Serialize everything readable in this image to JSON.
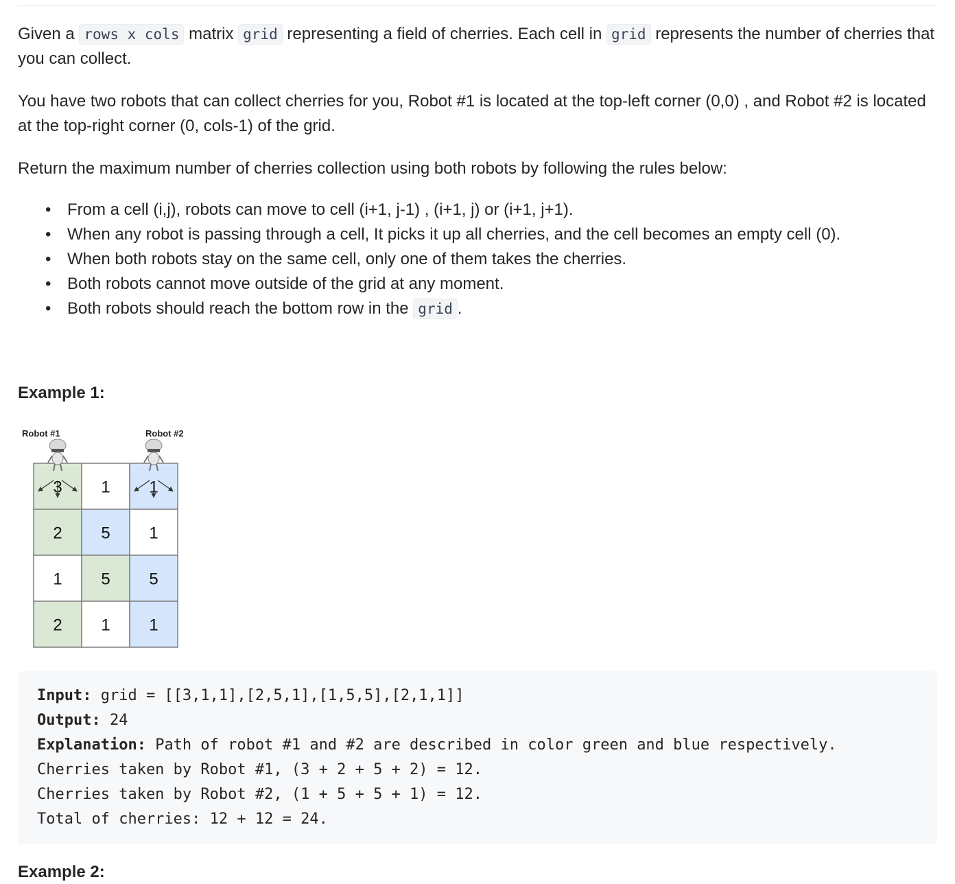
{
  "description": {
    "p1": {
      "t1": "Given a ",
      "code1": "rows x cols",
      "t2": " matrix ",
      "code2": "grid",
      "t3": " representing a field of cherries. Each cell in ",
      "code3": "grid",
      "t4": " represents the number of cherries that you can collect."
    },
    "p2": "You have two robots that can collect cherries for you, Robot #1 is located at the top-left corner (0,0) , and Robot #2 is located at the top-right corner (0, cols-1) of the grid.",
    "p3": "Return the maximum number of cherries collection using both robots  by following the rules below:",
    "rules": [
      "From a cell (i,j), robots can move to cell (i+1, j-1) , (i+1, j) or (i+1, j+1).",
      "When any robot is passing through a cell, It picks it up all cherries, and the cell becomes an empty cell (0).",
      "When both robots stay on the same cell, only one of them takes the cherries.",
      "Both robots cannot move outside of the grid at any moment."
    ],
    "rule5": {
      "t1": "Both robots should reach the bottom row in the ",
      "code": "grid",
      "t2": "."
    },
    "bullet": "•"
  },
  "example1": {
    "title": "Example 1:",
    "figure": {
      "robot1_label": "Robot #1",
      "robot2_label": "Robot #2",
      "grid": [
        [
          "3",
          "1",
          "1"
        ],
        [
          "2",
          "5",
          "1"
        ],
        [
          "1",
          "5",
          "5"
        ],
        [
          "2",
          "1",
          "1"
        ]
      ],
      "cell_colors": [
        [
          "green",
          "white",
          "blue"
        ],
        [
          "green",
          "blue",
          "white"
        ],
        [
          "white",
          "green",
          "blue"
        ],
        [
          "green",
          "white",
          "blue"
        ]
      ],
      "colors": {
        "green": "#dae8d5",
        "blue": "#d5e5fb",
        "white": "#ffffff",
        "border": "#7f7f7f"
      }
    },
    "input_label": "Input:",
    "input_value": " grid = [[3,1,1],[2,5,1],[1,5,5],[2,1,1]]",
    "output_label": "Output:",
    "output_value": " 24",
    "explanation_label": "Explanation:",
    "explanation_value": " Path of robot #1 and #2 are described in color green and blue respectively.",
    "line4": "Cherries taken by Robot #1, (3 + 2 + 5 + 2) = 12.",
    "line5": "Cherries taken by Robot #2, (1 + 5 + 5 + 1) = 12.",
    "line6": "Total of cherries: 12 + 12 = 24."
  },
  "example2": {
    "title": "Example 2:"
  }
}
